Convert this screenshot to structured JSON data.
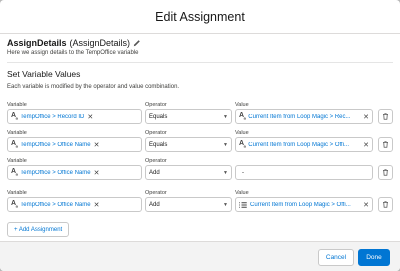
{
  "modal": {
    "title": "Edit Assignment"
  },
  "assignment": {
    "label": "AssignDetails",
    "api_name": "(AssignDetails)",
    "description": "Here we assign details to the TempOffice variable"
  },
  "section": {
    "title": "Set Variable Values",
    "description": "Each variable is modified by the operator and value combination."
  },
  "labels": {
    "variable": "Variable",
    "operator": "Operator",
    "value": "Value"
  },
  "rows": [
    {
      "variable": "TempOffice > Record ID",
      "operator": "Equals",
      "value": "Current Item from Loop Magic > Rec...",
      "value_icon": "text-type-icon"
    },
    {
      "variable": "TempOffice > Office Name",
      "operator": "Equals",
      "value": "Current Item from Loop Magic > Offi...",
      "value_icon": "text-type-icon"
    },
    {
      "variable": "TempOffice > Office Name",
      "operator": "Add",
      "value": "-",
      "value_icon": ""
    },
    {
      "variable": "TempOffice > Office Name",
      "operator": "Add",
      "value": "Current Item from Loop Magic > Offi...",
      "value_icon": "list-icon"
    }
  ],
  "add_button": "+ Add Assignment",
  "footer": {
    "cancel": "Cancel",
    "done": "Done"
  },
  "colors": {
    "accent": "#0176d3",
    "backdrop": "#b7b7b7"
  }
}
